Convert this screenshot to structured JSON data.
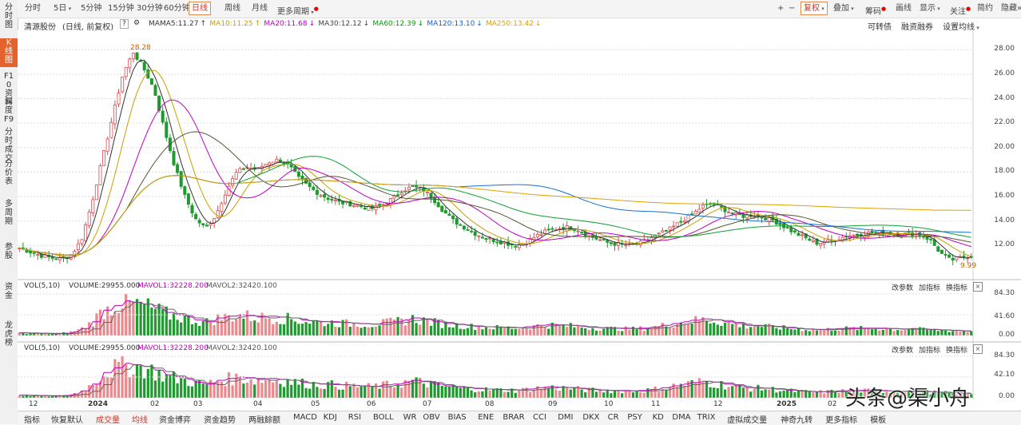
{
  "toolbar": {
    "period_tabs": [
      "分时",
      "5日",
      "5分钟",
      "15分钟",
      "30分钟",
      "60分钟",
      "日线",
      "周线",
      "月线",
      "更多周期"
    ],
    "active_tab": "日线",
    "right": {
      "plus": "+",
      "minus": "−",
      "fq": "复权",
      "overlay": "叠加",
      "chip": "筹码",
      "draw": "画线",
      "display": "显示",
      "watch": "关注",
      "brief": "简约",
      "hide": "隐藏"
    }
  },
  "sidebar": [
    "分时图",
    "K线图",
    "F10资料",
    "深度F9",
    "分时成交",
    "分价表",
    "多周期",
    "参股",
    "资金",
    "龙虎榜"
  ],
  "stock": {
    "name": "清源股份",
    "mode": "(日线, 前复权)"
  },
  "ma": [
    {
      "label": "MA",
      "value": "",
      "color": "#333333"
    },
    {
      "label": "MA5:",
      "value": "11.27",
      "color": "#333333",
      "arrow": "↑"
    },
    {
      "label": "MA10:",
      "value": "11.25",
      "color": "#c8a000",
      "arrow": "↑"
    },
    {
      "label": "MA20:",
      "value": "11.68",
      "color": "#c000c0",
      "arrow": "↓"
    },
    {
      "label": "MA30:",
      "value": "12.12",
      "color": "#444444",
      "arrow": "↓"
    },
    {
      "label": "MA60:",
      "value": "12.39",
      "color": "#00a000",
      "arrow": "↓"
    },
    {
      "label": "MA120:",
      "value": "13.10",
      "color": "#1060d0",
      "arrow": "↓"
    },
    {
      "label": "MA250:",
      "value": "13.42",
      "color": "#e0a000",
      "arrow": "↓"
    }
  ],
  "right_links": {
    "kzz": "可转债",
    "rzrq": "融资融券",
    "setma": "设置均线"
  },
  "vol1": {
    "title": "VOL(5,10)",
    "volume": "VOLUME:29955.000",
    "mavol1": "MAVOL1:32228.200",
    "mavol2": "MAVOL2:32420.100"
  },
  "vol2": {
    "title": "VOL(5,10)",
    "volume": "VOLUME:29955.000",
    "mavol1": "MAVOL1:32228.200",
    "mavol2": "MAVOL2:32420.100"
  },
  "panel_btns": {
    "param": "改参数",
    "add": "加指标",
    "switch": "换指标",
    "close": "×"
  },
  "annotations": {
    "high": "28.28",
    "low": "9.99"
  },
  "bottom_tabs": [
    "指标",
    "恢复默认",
    "成交量",
    "均线",
    "资金博弈",
    "资金趋势",
    "两融餘额",
    "MACD",
    "KDJ",
    "RSI",
    "BOLL",
    "WR",
    "OBV",
    "BIAS",
    "ENE",
    "BRAR",
    "CCI",
    "DMI",
    "DKX",
    "CR",
    "PSY",
    "KD",
    "DMA",
    "TRIX",
    "虚拟成交量",
    "神奇九转",
    "更多指标",
    "模板"
  ],
  "watermark": "头条@渠小舟",
  "chart_data": {
    "type": "candlestick",
    "price_axis": {
      "ticks": [
        28.0,
        26.0,
        24.0,
        22.0,
        20.0,
        18.0,
        16.0,
        14.0,
        12.0
      ],
      "ylim": [
        10.0,
        28.8
      ]
    },
    "vol1_axis": {
      "ticks": [
        "84.30",
        "41.60",
        "0.00"
      ]
    },
    "vol2_axis": {
      "ticks": [
        "84.30",
        "42.10",
        "0.00"
      ]
    },
    "x_labels": [
      "12",
      "2024",
      "02",
      "03",
      "04",
      "05",
      "06",
      "07",
      "08",
      "09",
      "10",
      "11",
      "12",
      "2025",
      "02"
    ],
    "close_path": [
      11.8,
      11.5,
      11.2,
      11.0,
      10.9,
      11.2,
      12.5,
      15.5,
      19.0,
      22.5,
      26.0,
      27.8,
      26.5,
      24.8,
      21.5,
      18.5,
      16.0,
      14.2,
      13.4,
      14.5,
      16.5,
      18.0,
      18.4,
      18.2,
      18.8,
      19.0,
      18.6,
      17.5,
      16.8,
      16.2,
      15.8,
      15.5,
      15.4,
      15.2,
      15.0,
      15.3,
      15.8,
      16.5,
      16.8,
      16.6,
      15.8,
      14.8,
      14.0,
      13.5,
      13.0,
      12.6,
      12.4,
      12.2,
      12.0,
      12.3,
      12.8,
      13.2,
      13.4,
      13.5,
      13.3,
      12.8,
      12.5,
      12.2,
      12.1,
      12.0,
      12.2,
      12.6,
      13.0,
      13.4,
      14.0,
      14.5,
      15.2,
      15.4,
      15.0,
      14.6,
      14.4,
      14.5,
      14.3,
      14.0,
      13.5,
      13.0,
      12.6,
      12.2,
      12.3,
      12.5,
      12.8,
      12.9,
      13.0,
      13.1,
      13.0,
      12.9,
      13.0,
      12.9,
      12.5,
      11.4,
      10.8,
      11.0,
      11.2
    ],
    "vol_series": [
      6,
      5,
      5,
      4,
      5,
      8,
      15,
      30,
      55,
      65,
      75,
      72,
      68,
      60,
      50,
      45,
      40,
      34,
      30,
      38,
      42,
      45,
      44,
      40,
      42,
      40,
      38,
      34,
      32,
      30,
      30,
      28,
      27,
      26,
      25,
      28,
      30,
      34,
      38,
      35,
      30,
      26,
      24,
      22,
      20,
      19,
      18,
      18,
      17,
      19,
      22,
      24,
      23,
      22,
      20,
      18,
      17,
      16,
      16,
      15,
      16,
      18,
      22,
      26,
      30,
      33,
      36,
      34,
      30,
      26,
      22,
      22,
      21,
      19,
      17,
      15,
      14,
      13,
      14,
      15,
      16,
      16,
      16,
      16,
      15,
      14,
      15,
      14,
      13,
      12,
      11,
      10,
      10
    ]
  }
}
